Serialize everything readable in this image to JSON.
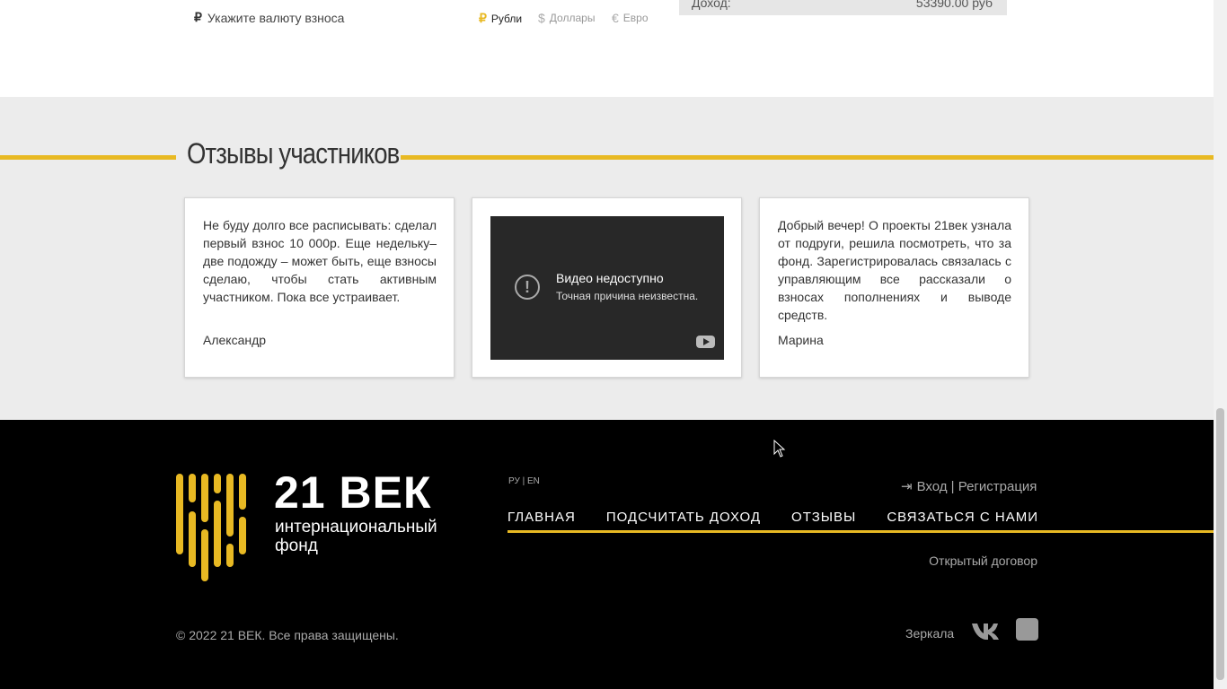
{
  "currency": {
    "symbol": "₽",
    "prompt": "Укажите валюту взноса",
    "options": [
      {
        "symbol": "₽",
        "label": "Рубли"
      },
      {
        "symbol": "$",
        "label": "Доллары"
      },
      {
        "symbol": "€",
        "label": "Евро"
      }
    ]
  },
  "income": {
    "label": "Доход:",
    "value": "53390.00 руб"
  },
  "reviews": {
    "title": "Отзывы участников",
    "cards": [
      {
        "text": "Не буду долго все расписывать: сделал первый взнос 10 000р. Еще недельку–две подожду – может быть, еще взносы сделаю, чтобы стать активным участником. Пока все устраивает.",
        "author": "Александр"
      },
      {
        "video_title": "Видео недоступно",
        "video_sub": "Точная причина неизвестна."
      },
      {
        "text": "Добрый вечер! О проекты 21век узнала от подруги, решила посмотреть, что за фонд. Зарегистрировалась связалась с управляющим все рассказали о взносах пополнениях и выводе средств.",
        "author": "Марина"
      }
    ]
  },
  "footer": {
    "logo_big": "21 ВЕК",
    "logo_line1": "интернациональный",
    "logo_line2": "фонд",
    "lang": "РУ | EN",
    "login": "Вход | Регистрация",
    "nav": [
      "ГЛАВНАЯ",
      "ПОДСЧИТАТЬ ДОХОД",
      "ОТЗЫВЫ",
      "СВЯЗАТЬСЯ С НАМИ"
    ],
    "contract": "Открытый договор",
    "copyright": "© 2022 21 ВЕК. Все права защищены.",
    "mirrors": "Зеркала",
    "accent_color": "#e8b923"
  }
}
